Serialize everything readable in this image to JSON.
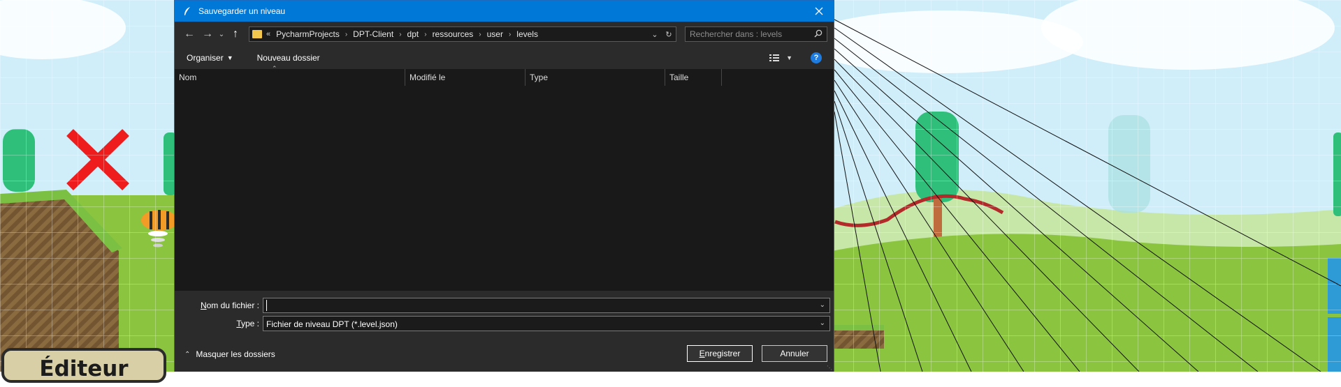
{
  "window": {
    "title": "Sauvegarder un niveau"
  },
  "address": {
    "overflow": "«",
    "crumbs": [
      "PycharmProjects",
      "DPT-Client",
      "dpt",
      "ressources",
      "user",
      "levels"
    ]
  },
  "search": {
    "placeholder": "Rechercher dans : levels"
  },
  "toolbar": {
    "organize": "Organiser",
    "new_folder": "Nouveau dossier"
  },
  "columns": [
    "Nom",
    "Modifié le",
    "Type",
    "Taille"
  ],
  "form": {
    "filename_label_u": "N",
    "filename_label_rest": "om du fichier :",
    "filename_value": "",
    "type_label_u": "T",
    "type_label_rest": "ype :",
    "type_value": "Fichier de niveau DPT (*.level.json)"
  },
  "footer": {
    "hide_folders": "Masquer les dossiers",
    "save_u": "E",
    "save_rest": "nregistrer",
    "cancel": "Annuler"
  },
  "game": {
    "editor_badge": "Éditeur"
  },
  "colors": {
    "accent": "#0078d7",
    "dialog_bg": "#202020",
    "panel_bg": "#2b2b2b"
  }
}
